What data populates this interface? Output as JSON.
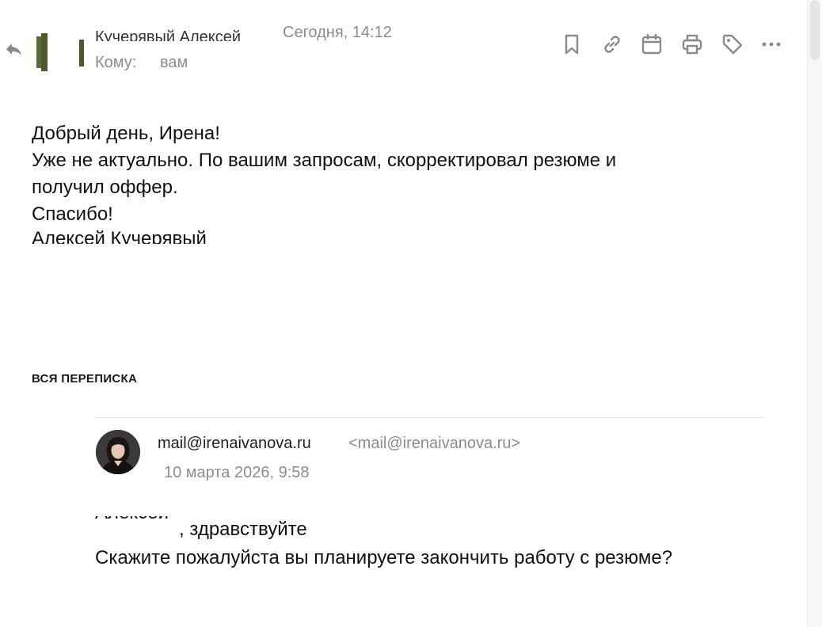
{
  "message": {
    "sender_name": "Кучерявый Алексей",
    "date": "Сегодня, 14:12",
    "to_label": "Кому:",
    "to_value": "вам",
    "body": {
      "greeting": "Добрый день, Ирена!",
      "line1": "Уже не актуально. По вашим запросам, скорректировал резюме и",
      "line2": "получил оффер.",
      "thanks": "Спасибо!",
      "signature": "Алексей Кучерявый"
    }
  },
  "toolbar": {
    "items": [
      {
        "icon": "bookmark-icon"
      },
      {
        "icon": "link-icon"
      },
      {
        "icon": "calendar-icon"
      },
      {
        "icon": "print-icon"
      },
      {
        "icon": "tag-icon"
      },
      {
        "icon": "more-icon"
      }
    ],
    "icon_color": "#8a8a8a"
  },
  "thread": {
    "heading": "ВСЯ ПЕРЕПИСКА",
    "from_name": "mail@irenaivanova.ru",
    "from_email": "<mail@irenaivanova.ru>",
    "date": "10 марта 2026, 9:58",
    "greeting_name": "Алексей",
    "greeting_rest": ", здравствуйте",
    "question": "Скажите пожалуйста вы планируете закончить работу с резюме?"
  }
}
